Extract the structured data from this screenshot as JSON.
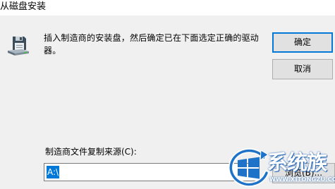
{
  "window": {
    "title": "从磁盘安装"
  },
  "dialog": {
    "icon": "floppy-disk-icon",
    "message": "插入制造商的安装盘，然后确定已在下面选定正确的驱动器。",
    "ok_label": "确定",
    "cancel_label": "取消",
    "path_label": "制造商文件复制来源(C):",
    "path_value": "A:\\",
    "browse_label": "浏览(B)..."
  },
  "watermark": {
    "icon": "windows-logo-icon",
    "text": "系统族",
    "url": "WWW.XITONGZU.COM"
  }
}
